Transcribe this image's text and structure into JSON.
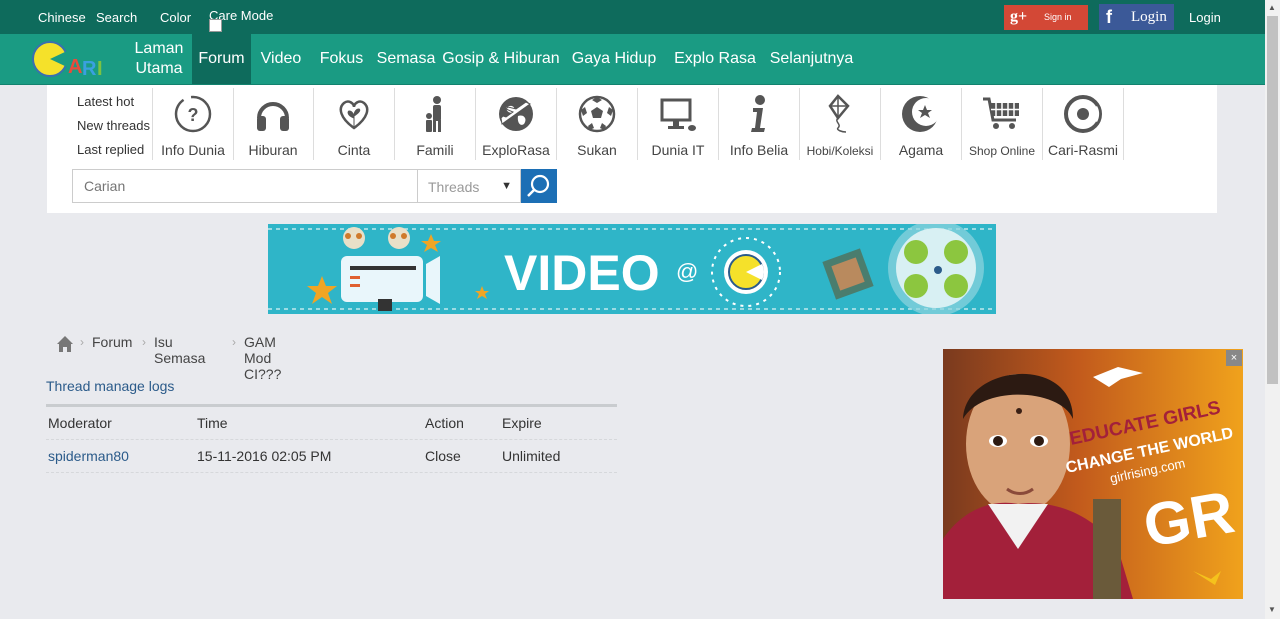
{
  "topbar": {
    "links": [
      "Chinese",
      "Search",
      "Color"
    ],
    "care_mode": "Care Mode",
    "gplus_label": "Sign in",
    "fb_label": "Login",
    "login_label": "Login",
    "colors": {
      "bar": "#0e6b5c",
      "gplus": "#d34836",
      "facebook": "#3b5998"
    }
  },
  "nav": {
    "logo_alt": "CARI",
    "items": [
      "Laman Utama",
      "Forum",
      "Video",
      "Fokus",
      "Semasa",
      "Gosip & Hiburan",
      "Gaya Hidup",
      "Explo Rasa",
      "Selanjutnya"
    ],
    "active": "Forum",
    "color": "#1a9b83"
  },
  "quick_links": [
    "Latest hot",
    "New threads",
    "Last replied"
  ],
  "categories": [
    {
      "label": "Info Dunia",
      "icon": "globe-question-icon"
    },
    {
      "label": "Hiburan",
      "icon": "headphones-icon"
    },
    {
      "label": "Cinta",
      "icon": "heart-sprout-icon"
    },
    {
      "label": "Famili",
      "icon": "family-icon"
    },
    {
      "label": "ExploRasa",
      "icon": "globe-plane-icon"
    },
    {
      "label": "Sukan",
      "icon": "soccer-ball-icon"
    },
    {
      "label": "Dunia IT",
      "icon": "computer-icon"
    },
    {
      "label": "Info Belia",
      "icon": "info-icon"
    },
    {
      "label": "Hobi/Koleksi",
      "icon": "kite-icon"
    },
    {
      "label": "Agama",
      "icon": "crescent-star-icon"
    },
    {
      "label": "Shop Online",
      "icon": "cart-icon"
    },
    {
      "label": "Cari-Rasmi",
      "icon": "cari-logo-icon"
    }
  ],
  "search": {
    "placeholder": "Carian",
    "scope": "Threads",
    "button_color": "#1c6fb5"
  },
  "banner": {
    "text": "VIDEO",
    "at": "@"
  },
  "breadcrumb": [
    "Forum",
    "Isu Semasa",
    "GAM Mod CI???"
  ],
  "logs": {
    "title": "Thread manage logs",
    "headers": [
      "Moderator",
      "Time",
      "Action",
      "Expire"
    ],
    "rows": [
      {
        "moderator": "spiderman80",
        "time": "15-11-2016 02:05 PM",
        "action": "Close",
        "expire": "Unlimited"
      }
    ]
  },
  "ad": {
    "line1": "EDUCATE GIRLS",
    "line2": "CHANGE THE WORLD",
    "url": "girlrising.com",
    "big": "GR",
    "close": "×"
  }
}
